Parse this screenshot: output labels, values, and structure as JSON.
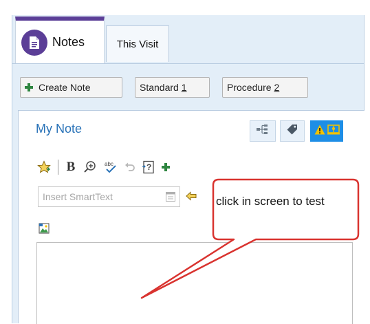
{
  "tabs": {
    "notes_label": "Notes",
    "visit_label": "This Visit"
  },
  "toolbar": {
    "create_note_label": "Create Note",
    "standard_label": "Standard ",
    "standard_key": "1",
    "procedure_label": "Procedure ",
    "procedure_key": "2"
  },
  "note": {
    "title": "My Note",
    "header_icons": [
      "share-tree-icon",
      "tag-icon",
      "warning-book-icon"
    ],
    "formatting_icons": [
      "favorite-star-icon",
      "bold-icon",
      "zoom-in-icon",
      "spellcheck-icon",
      "undo-icon",
      "help-insert-icon",
      "add-icon"
    ],
    "smarttext_placeholder": "Insert SmartText",
    "editor_text": ""
  },
  "callout": {
    "text": "click in screen to test"
  },
  "colors": {
    "accent_purple": "#5b3e97",
    "link_blue": "#2a73b8",
    "alert_blue": "#1e8ee6",
    "warning_yellow": "#f2c200",
    "callout_border": "#d9332f",
    "plus_green": "#2e8540"
  }
}
